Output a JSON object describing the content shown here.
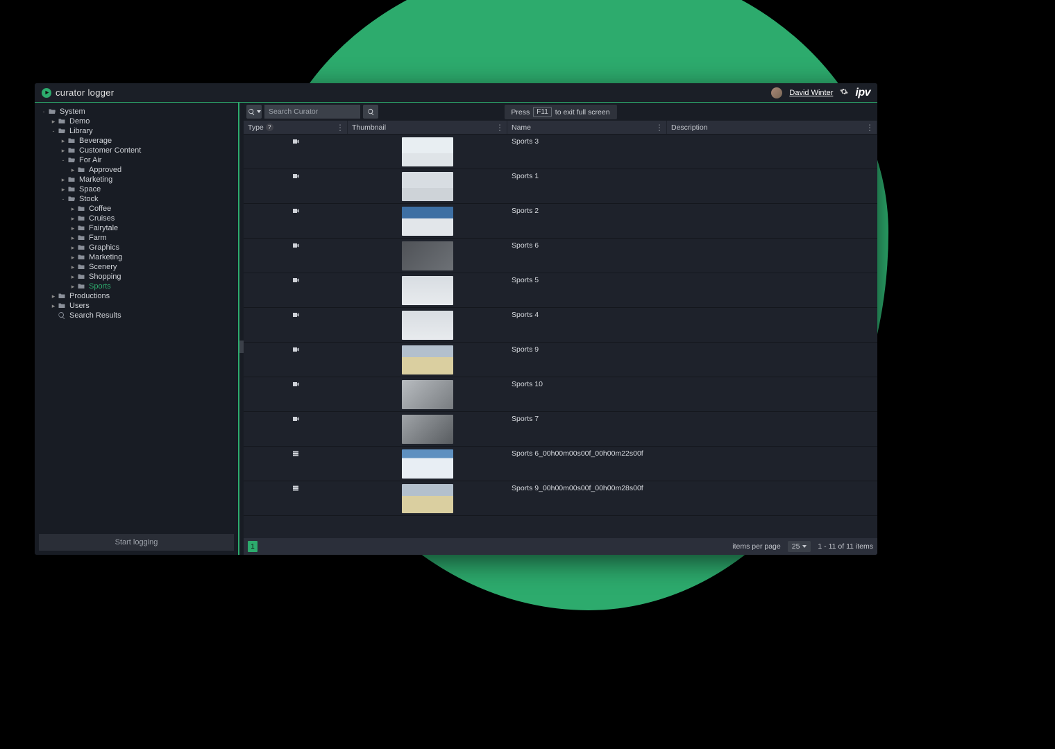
{
  "app": {
    "title": "curator logger",
    "brand": "ipv"
  },
  "user": {
    "name": "David Winter"
  },
  "sidebar": {
    "start_logging": "Start logging",
    "tree": [
      {
        "label": "System",
        "icon": "folder-open",
        "depth": 0,
        "toggle": "-",
        "active": false
      },
      {
        "label": "Demo",
        "icon": "folder",
        "depth": 1,
        "toggle": "▸",
        "active": false
      },
      {
        "label": "Library",
        "icon": "folder-open",
        "depth": 1,
        "toggle": "-",
        "active": false
      },
      {
        "label": "Beverage",
        "icon": "folder",
        "depth": 2,
        "toggle": "▸",
        "active": false
      },
      {
        "label": "Customer Content",
        "icon": "folder",
        "depth": 2,
        "toggle": "▸",
        "active": false
      },
      {
        "label": "For Air",
        "icon": "folder-open",
        "depth": 2,
        "toggle": "-",
        "active": false
      },
      {
        "label": "Approved",
        "icon": "folder",
        "depth": 3,
        "toggle": "▸",
        "active": false
      },
      {
        "label": "Marketing",
        "icon": "folder",
        "depth": 2,
        "toggle": "▸",
        "active": false
      },
      {
        "label": "Space",
        "icon": "folder",
        "depth": 2,
        "toggle": "▸",
        "active": false
      },
      {
        "label": "Stock",
        "icon": "folder-open",
        "depth": 2,
        "toggle": "-",
        "active": false
      },
      {
        "label": "Coffee",
        "icon": "folder",
        "depth": 3,
        "toggle": "▸",
        "active": false
      },
      {
        "label": "Cruises",
        "icon": "folder",
        "depth": 3,
        "toggle": "▸",
        "active": false
      },
      {
        "label": "Fairytale",
        "icon": "folder",
        "depth": 3,
        "toggle": "▸",
        "active": false
      },
      {
        "label": "Farm",
        "icon": "folder",
        "depth": 3,
        "toggle": "▸",
        "active": false
      },
      {
        "label": "Graphics",
        "icon": "folder",
        "depth": 3,
        "toggle": "▸",
        "active": false
      },
      {
        "label": "Marketing",
        "icon": "folder",
        "depth": 3,
        "toggle": "▸",
        "active": false
      },
      {
        "label": "Scenery",
        "icon": "folder",
        "depth": 3,
        "toggle": "▸",
        "active": false
      },
      {
        "label": "Shopping",
        "icon": "folder",
        "depth": 3,
        "toggle": "▸",
        "active": false
      },
      {
        "label": "Sports",
        "icon": "folder",
        "depth": 3,
        "toggle": "▸",
        "active": true
      },
      {
        "label": "Productions",
        "icon": "folder",
        "depth": 1,
        "toggle": "▸",
        "active": false
      },
      {
        "label": "Users",
        "icon": "folder",
        "depth": 1,
        "toggle": "▸",
        "active": false
      },
      {
        "label": "Search Results",
        "icon": "search",
        "depth": 1,
        "toggle": "",
        "active": false
      }
    ]
  },
  "toolbar": {
    "search_placeholder": "Search Curator",
    "fullscreen_hint": {
      "pre": "Press",
      "key": "F11",
      "post": "to exit full screen"
    }
  },
  "columns": {
    "type": "Type",
    "thumbnail": "Thumbnail",
    "name": "Name",
    "description": "Description"
  },
  "rows": [
    {
      "type": "video",
      "name": "Sports 3",
      "thumb_class": "thumb-sky"
    },
    {
      "type": "video",
      "name": "Sports 1",
      "thumb_class": "thumb-sky2"
    },
    {
      "type": "video",
      "name": "Sports 2",
      "thumb_class": "thumb-blue"
    },
    {
      "type": "video",
      "name": "Sports 6",
      "thumb_class": "thumb-gray"
    },
    {
      "type": "video",
      "name": "Sports 5",
      "thumb_class": "thumb-light"
    },
    {
      "type": "video",
      "name": "Sports 4",
      "thumb_class": "thumb-light"
    },
    {
      "type": "video",
      "name": "Sports 9",
      "thumb_class": "thumb-wall"
    },
    {
      "type": "video",
      "name": "Sports 10",
      "thumb_class": "thumb-rock"
    },
    {
      "type": "video",
      "name": "Sports 7",
      "thumb_class": "thumb-rock2"
    },
    {
      "type": "subclip",
      "name": "Sports 6_00h00m00s00f_00h00m22s00f",
      "thumb_class": "thumb-snow"
    },
    {
      "type": "subclip",
      "name": "Sports 9_00h00m00s00f_00h00m28s00f",
      "thumb_class": "thumb-wall"
    }
  ],
  "footer": {
    "page": "1",
    "items_per_page_label": "items per page",
    "items_per_page_value": "25",
    "range": "1 - 11 of 11 items"
  }
}
